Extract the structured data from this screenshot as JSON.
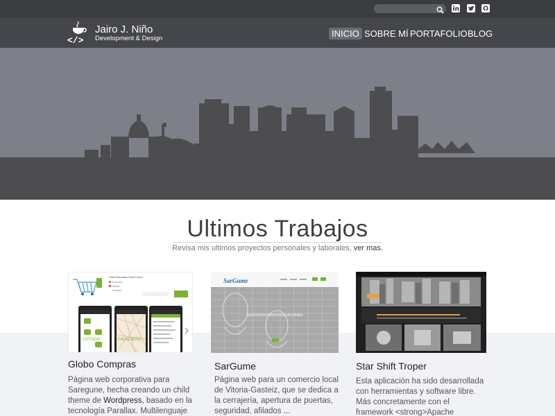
{
  "topbar": {
    "search_placeholder": "",
    "search_icon": "search-icon",
    "social": [
      "linkedin-icon",
      "twitter-icon",
      "github-icon"
    ]
  },
  "brand": {
    "name": "Jairo J. Niño",
    "tagline": "Development & Design"
  },
  "nav": {
    "items": [
      {
        "label": "INICIO",
        "active": true
      },
      {
        "label": "SOBRE MÍ",
        "active": false
      },
      {
        "label": "PORTAFOLIO",
        "active": false
      },
      {
        "label": "BLOG",
        "active": false
      }
    ]
  },
  "section": {
    "title": "Ultimos Trabajos",
    "subtitle": "Revisa mis ultimos proyectos personales y laborales,",
    "subtitle_link": "ver mas."
  },
  "works": [
    {
      "title": "Globo Compras",
      "desc_1": "Página web corporativa para Saregune, hecha creando un child theme de ",
      "desc_bold": "Wordpress",
      "desc_2": ", basado en la tecnología Parallax. Multilenguaje"
    },
    {
      "title": "SarGume",
      "desc": "Página web para un comercio local de Vitoria-Gasteiz, que se dedica a la cerrajería, apertura de puertas, seguridad, afilados ...",
      "thumb_logo": "SarGume",
      "thumb_banner": "SERVICIOS PARA ASOCIACIONES"
    },
    {
      "title": "Star Shift Troper",
      "desc": "Esta aplicación ha sido desarrollada con herramientas y software libre. Más concretamente con el framework <strong>Apache"
    }
  ],
  "thumb1": {
    "store": "Saal Ikastolako Ikasle-Asoc.",
    "menu": [
      "Productos",
      "Ofertas",
      "Contacto",
      "Registrarse",
      "Carrito"
    ],
    "tabs": [
      "LISTADO",
      "CALLEJERO"
    ],
    "btn": "Añadir"
  },
  "colors": {
    "topbar": "#3a3c40",
    "header": "#44464b",
    "hero_sky": "#7d8088",
    "skyline": "#4d4d4f",
    "accent_green": "#7bb32e"
  }
}
